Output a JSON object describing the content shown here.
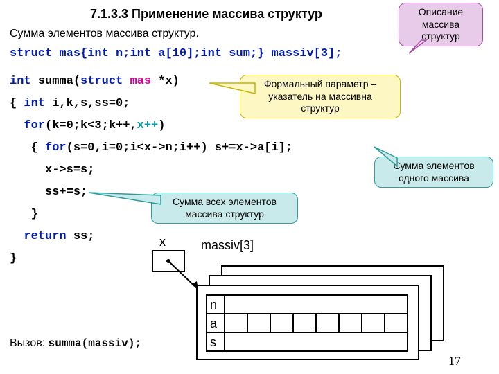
{
  "title": "7.1.3.3 Применение массива структур",
  "subtitle": "Сумма элементов массива структур.",
  "page_num": "17",
  "call_prefix": "Вызов: ",
  "call_code": "summa(massiv);",
  "callouts": {
    "desc": "Описание\nмассива\nструктур",
    "param": "Формальный параметр –\nуказатель на массивна\nструктур",
    "all_sum": "Сумма всех элементов\nмассива структур",
    "one_sum": "Сумма элементов\nодного массива"
  },
  "code": {
    "struct_decl": {
      "kw1": "struct ",
      "t1": "mas{",
      "kw2": "int ",
      "t2": "n;",
      "kw3": "int ",
      "t3": "a[10];",
      "kw4": "int ",
      "t4": "sum;} massiv[3];"
    },
    "fn_sig": {
      "kw1": "int ",
      "name": "summa(",
      "kw2": "struct ",
      "type": "mas ",
      "arg": "*x",
      "close": ")"
    },
    "l1": {
      "a": "{ ",
      "kw": "int ",
      "b": "i,k,s,ss=0;"
    },
    "l2": {
      "sp": "  ",
      "kw": "for",
      "a": "(k=0;k<3;k++,",
      "x": "x++",
      "b": ")"
    },
    "l3": {
      "sp": "   ",
      "a": "{ ",
      "kw": "for",
      "b": "(s=0,i=0;i<x->n;i++) s+=x->a[i];"
    },
    "l4": "     x->s=s;",
    "l5": "     ss+=s;",
    "l6": "   }",
    "l7": {
      "sp": "  ",
      "kw": "return ",
      "a": "ss;"
    },
    "l8": "}",
    "diag": {
      "x": "x",
      "arr": "massiv[3]",
      "n": "n",
      "a": "a",
      "s": "s"
    }
  }
}
